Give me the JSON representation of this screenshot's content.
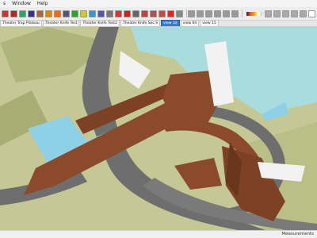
{
  "menu": [
    "s",
    "Window",
    "Help"
  ],
  "toolbar": {
    "icons": [
      {
        "name": "arrow-select-icon",
        "color": "#c33"
      },
      {
        "name": "move-icon",
        "color": "#b22"
      },
      {
        "name": "rotate-icon",
        "color": "#2a6"
      },
      {
        "name": "scale-icon",
        "color": "#338"
      },
      {
        "name": "push-pull-icon",
        "color": "#a63"
      },
      {
        "name": "offset-icon",
        "color": "#d80"
      },
      {
        "name": "follow-me-icon",
        "color": "#f60"
      },
      {
        "name": "tape-icon",
        "color": "#557"
      },
      {
        "name": "protractor-icon",
        "color": "#2a2"
      },
      {
        "name": "axes-icon",
        "color": "#cc2"
      },
      {
        "name": "text-icon",
        "color": "#39c"
      },
      {
        "name": "dimension-icon",
        "color": "#55a"
      },
      {
        "name": "orbit-icon",
        "color": "#777"
      },
      {
        "name": "pan-icon",
        "color": "#d33"
      },
      {
        "name": "zoom-icon",
        "color": "#c22"
      },
      {
        "name": "zoom-extents-icon",
        "color": "#666"
      },
      {
        "name": "section-plane-icon",
        "color": "#b44"
      },
      {
        "name": "paint-bucket-icon",
        "color": "#a55"
      },
      {
        "name": "eraser-icon",
        "color": "#c44"
      },
      {
        "name": "component-icon",
        "color": "#e22"
      },
      {
        "name": "layers-icon",
        "color": "#888"
      },
      {
        "name": "view-iso-icon",
        "color": "#999"
      },
      {
        "name": "view-top-icon",
        "color": "#999"
      },
      {
        "name": "view-front-icon",
        "color": "#999"
      },
      {
        "name": "view-right-icon",
        "color": "#999"
      },
      {
        "name": "view-back-icon",
        "color": "#999"
      },
      {
        "name": "view-left-icon",
        "color": "#999"
      },
      {
        "name": "style-xray-icon",
        "color": "#aaa"
      },
      {
        "name": "style-wire-icon",
        "color": "#aaa"
      },
      {
        "name": "style-hidden-icon",
        "color": "#aaa"
      },
      {
        "name": "style-shaded-icon",
        "color": "#aaa"
      },
      {
        "name": "style-textured-icon",
        "color": "#aaa"
      },
      {
        "name": "shadow-toggle-icon",
        "color": "#fff"
      }
    ],
    "ramp_name": "shadow-time-ramp"
  },
  "tabs": [
    {
      "label": "Theater Trap Plateau",
      "active": false
    },
    {
      "label": "Theater Knife Test",
      "active": false
    },
    {
      "label": "Theater Knife Test2",
      "active": false
    },
    {
      "label": "Theater Knife Sec S",
      "active": false
    },
    {
      "label": "view 32",
      "active": true
    },
    {
      "label": "view 04",
      "active": false
    },
    {
      "label": "view 15",
      "active": false
    }
  ],
  "status": {
    "left": "",
    "measurements_label": "Measurements"
  },
  "colors": {
    "terrain": "#c5c895",
    "road": "#6e6e6e",
    "water": "#a9dcdc",
    "structure": "#8a4a2b",
    "glass": "#8ed0e6",
    "white_volume": "#f2f2f2"
  }
}
